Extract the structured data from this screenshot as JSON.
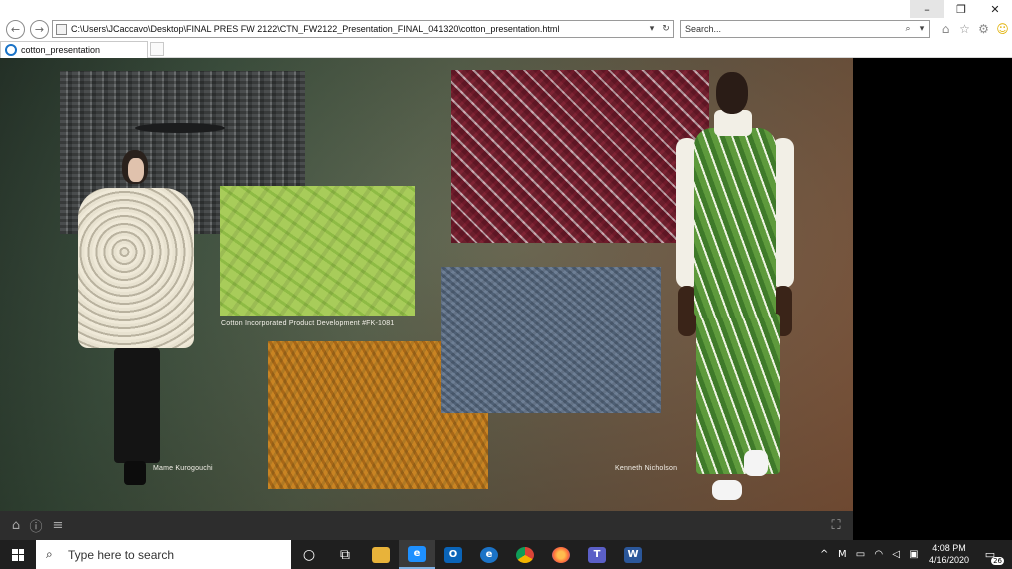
{
  "browser": {
    "address": "C:\\Users\\JCaccavo\\Desktop\\FINAL PRES FW 2122\\CTN_FW2122_Presentation_FINAL_041320\\cotton_presentation.html",
    "search_placeholder": "Search...",
    "tab_title": "cotton_presentation",
    "window_buttons": {
      "minimize": "–",
      "restore": "❐",
      "close": "✕"
    },
    "nav": {
      "back": "←",
      "forward": "→"
    },
    "address_controls": {
      "dropdown": "▾",
      "refresh": "↻"
    },
    "search_controls": {
      "search": "⌕",
      "dropdown": "▾"
    },
    "tools": {
      "home": "⌂",
      "favorites": "☆",
      "settings": "⚙",
      "feedback": "☺"
    }
  },
  "slide": {
    "captions": {
      "product": "Cotton Incorporated Product Development #FK-1081",
      "left_model": "Mame Kurogouchi",
      "right_model": "Kenneth Nicholson"
    }
  },
  "viewer_bar": {
    "home": "⌂",
    "info": "ⓘ",
    "menu": "≡",
    "fullscreen": "⛶"
  },
  "taskbar": {
    "search_placeholder": "Type here to search",
    "apps": [
      {
        "name": "task-view",
        "glyph": "○"
      },
      {
        "name": "task-switch",
        "glyph": "⧉"
      },
      {
        "name": "file-explorer",
        "glyph": "▆",
        "color": "#e8b33a"
      },
      {
        "name": "internet-explorer",
        "glyph": "e",
        "color": "#1e90ff"
      },
      {
        "name": "outlook",
        "glyph": "O",
        "color": "#0a64b8"
      },
      {
        "name": "edge",
        "glyph": "e",
        "color": "#1b73c7"
      },
      {
        "name": "chrome",
        "glyph": "●",
        "color": "#4caf50"
      },
      {
        "name": "firefox",
        "glyph": "●",
        "color": "#ff7139"
      },
      {
        "name": "teams",
        "glyph": "T",
        "color": "#5b5fc7"
      },
      {
        "name": "word",
        "glyph": "W",
        "color": "#2b579a"
      }
    ],
    "tray": {
      "chevron": "^",
      "glyphs": "M ▭ ◠ ◁ ▣"
    },
    "time": "4:08 PM",
    "date": "4/16/2020",
    "notifications": "26"
  }
}
